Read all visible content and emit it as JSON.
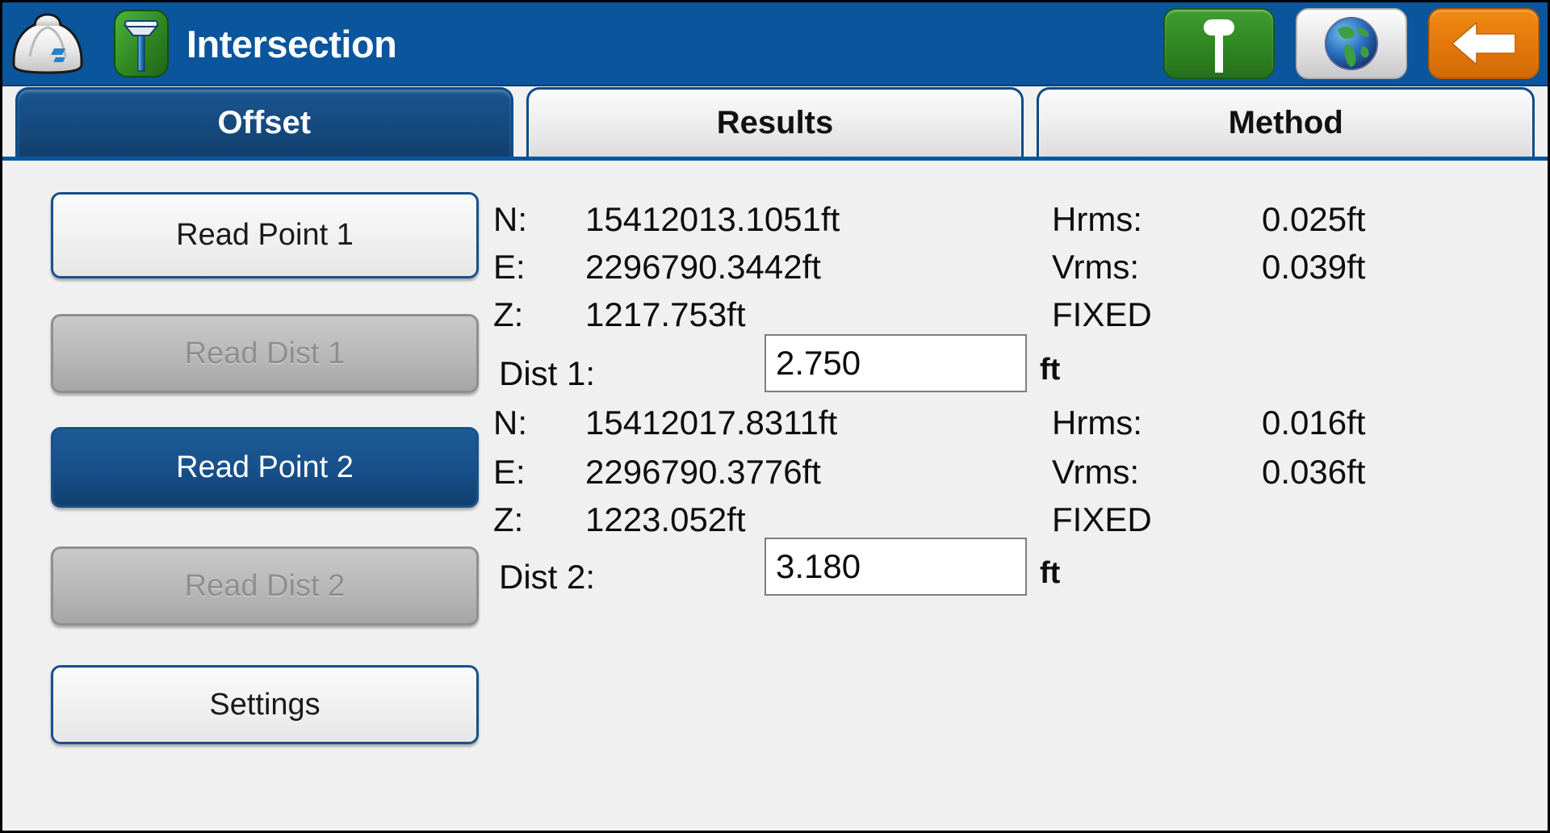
{
  "titlebar": {
    "helmet_icon": "hard-hat-icon",
    "app_icon": "gnss-antenna-icon",
    "title": "Intersection",
    "buttons": [
      {
        "name": "antenna-button",
        "icon": "antenna-icon",
        "color": "#2f8722"
      },
      {
        "name": "globe-button",
        "icon": "globe-icon",
        "color": "#e2e2e2"
      },
      {
        "name": "back-button",
        "icon": "arrow-left-icon",
        "color": "#e2760a"
      }
    ]
  },
  "tabs": [
    {
      "label": "Offset",
      "active": true
    },
    {
      "label": "Results",
      "active": false
    },
    {
      "label": "Method",
      "active": false
    }
  ],
  "buttons": {
    "read_point_1": "Read Point 1",
    "read_dist_1": "Read Dist 1",
    "read_point_2": "Read Point 2",
    "read_dist_2": "Read Dist 2",
    "settings": "Settings"
  },
  "point1": {
    "n_label": "N:",
    "n_value": "15412013.1051ft",
    "e_label": "E:",
    "e_value": "2296790.3442ft",
    "z_label": "Z:",
    "z_value": "1217.753ft",
    "hrms_label": "Hrms:",
    "hrms_value": "0.025ft",
    "vrms_label": "Vrms:",
    "vrms_value": "0.039ft",
    "status": "FIXED"
  },
  "point2": {
    "n_label": "N:",
    "n_value": "15412017.8311ft",
    "e_label": "E:",
    "e_value": "2296790.3776ft",
    "z_label": "Z:",
    "z_value": "1223.052ft",
    "hrms_label": "Hrms:",
    "hrms_value": "0.016ft",
    "vrms_label": "Vrms:",
    "vrms_value": "0.036ft",
    "status": "FIXED"
  },
  "dist1": {
    "label": "Dist 1:",
    "value": "2.750",
    "unit": "ft"
  },
  "dist2": {
    "label": "Dist 2:",
    "value": "3.180",
    "unit": "ft"
  },
  "colors": {
    "title_bar": "#0a559c",
    "accent_blue": "#17518c",
    "background": "#f0f0f0",
    "green": "#2f8722",
    "orange": "#e2760a"
  }
}
